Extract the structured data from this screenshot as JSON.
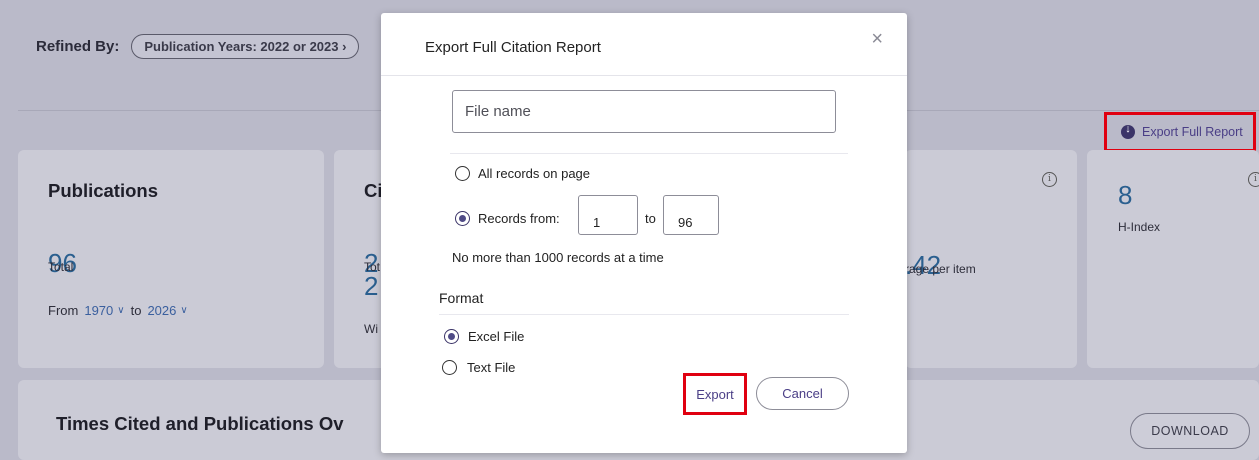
{
  "refined_by": {
    "label": "Refined By:",
    "chip": "Publication Years: 2022 or 2023"
  },
  "export_full_report": {
    "label": "Export Full Report",
    "icon": "download-circle-icon"
  },
  "cards": {
    "publications": {
      "title": "Publications",
      "value": "96",
      "sub": "Total",
      "from_label": "From",
      "from_year": "1970",
      "to_label": "to",
      "to_year": "2026"
    },
    "citations": {
      "title_fragment": "Ci",
      "value1_fragment": "2",
      "sub1_fragment": "Tot",
      "value2_fragment": "2",
      "sub2_fragment": "Wi"
    },
    "average": {
      "value_fragment": ".42",
      "sub_fragment": "rage per item"
    },
    "hindex": {
      "value": "8",
      "sub": "H-Index"
    }
  },
  "times_cited": {
    "title_fragment": "Times Cited and Publications Ov",
    "download_label": "DOWNLOAD"
  },
  "modal": {
    "title": "Export Full Citation Report",
    "close_symbol": "×",
    "filename_placeholder": "File name",
    "options": {
      "all_records": "All records on page",
      "records_from": "Records from:",
      "records_to": "to",
      "from_value": "1",
      "to_value": "96",
      "selected": "records_from"
    },
    "note": "No more than 1000 records at a time",
    "format": {
      "label": "Format",
      "excel": "Excel File",
      "text": "Text File",
      "selected": "excel"
    },
    "export_label": "Export",
    "cancel_label": "Cancel"
  },
  "colors": {
    "overlay_bg": "#babac9",
    "highlight_red": "#e00010",
    "link_purple": "#4a3e86",
    "number_blue": "#2a5f8f"
  }
}
